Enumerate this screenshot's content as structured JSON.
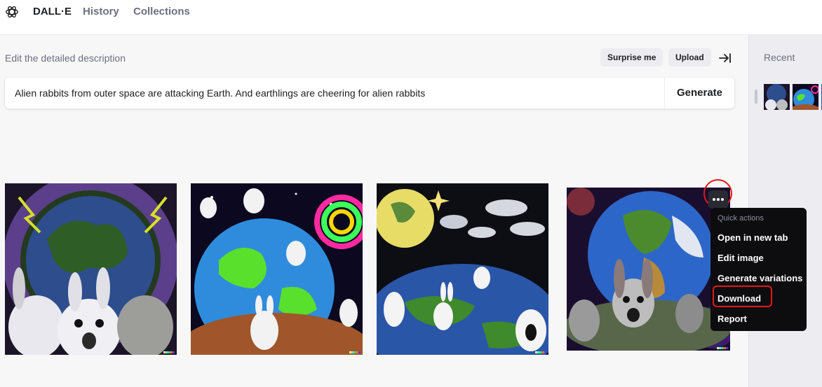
{
  "nav": {
    "brand": "DALL·E",
    "history": "History",
    "collections": "Collections"
  },
  "editor": {
    "label": "Edit the detailed description",
    "surprise_label": "Surprise me",
    "upload_label": "Upload",
    "prompt": "Alien rabbits from outer space are attacking Earth. And earthlings are cheering for alien rabbits",
    "generate_label": "Generate"
  },
  "sidebar": {
    "recent_label": "Recent"
  },
  "menu": {
    "header": "Quick actions",
    "items": [
      "Open in new tab",
      "Edit image",
      "Generate variations",
      "Download",
      "Report"
    ],
    "highlighted": "Download"
  },
  "icons": {
    "logo": "openai-logo-icon",
    "collapse": "collapse-panel-icon",
    "more": "more-horizontal-icon"
  },
  "colors": {
    "highlight_red": "#e0191b",
    "menu_bg": "#0d0d0f",
    "pill_bg": "#ececf1"
  }
}
